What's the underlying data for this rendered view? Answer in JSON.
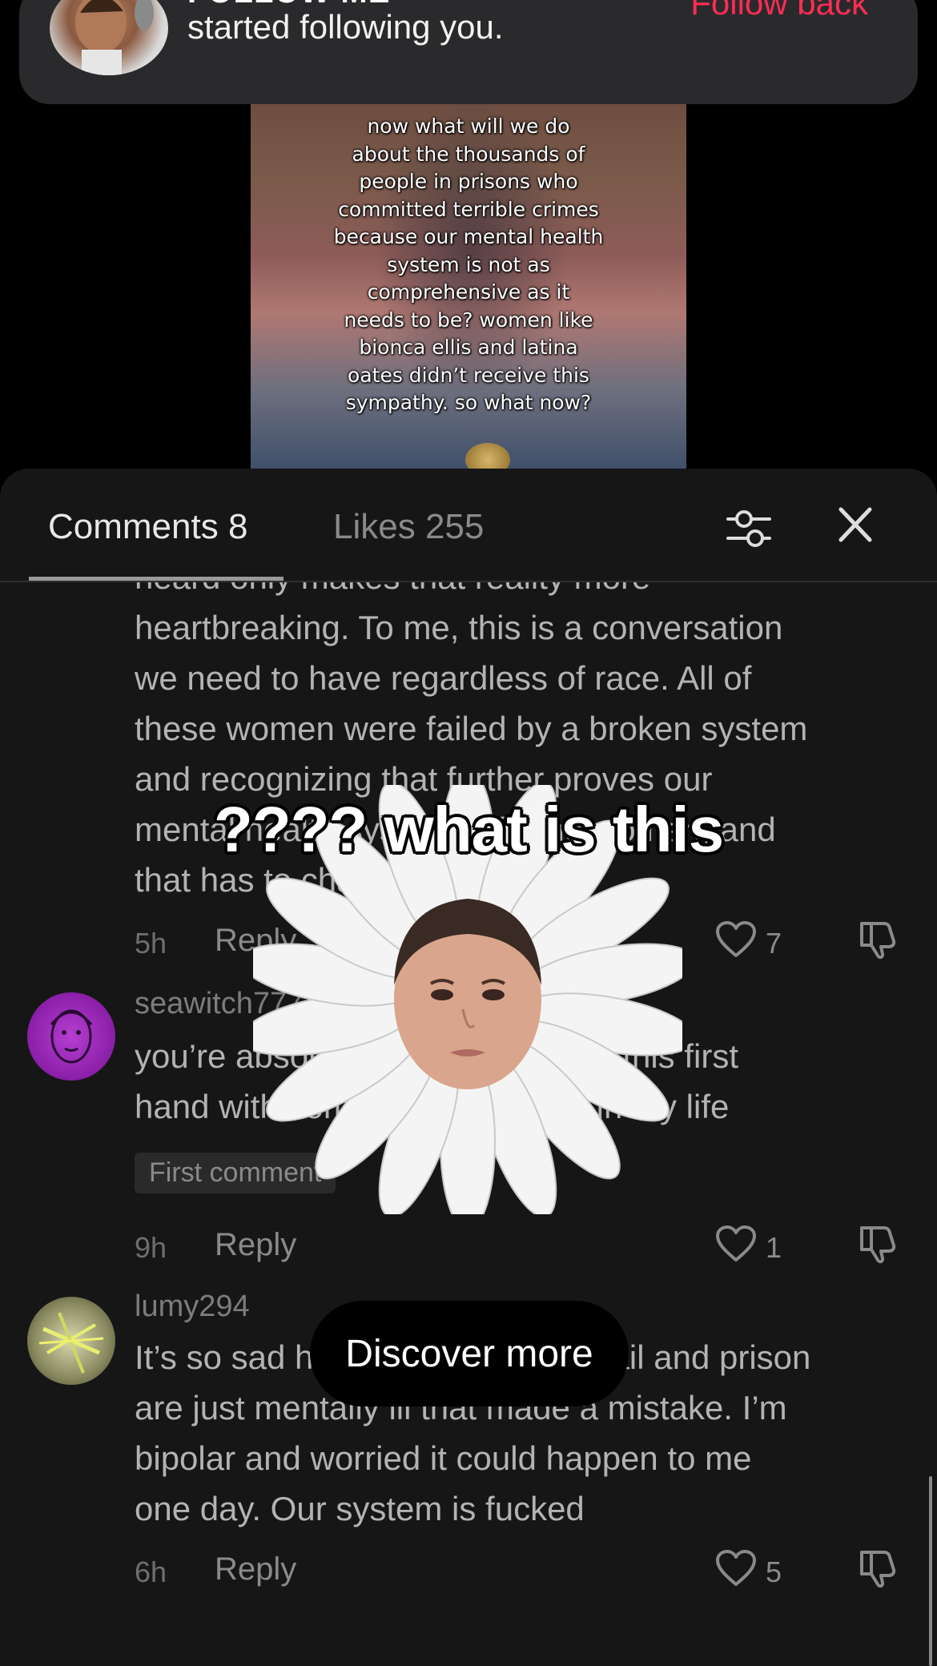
{
  "notification": {
    "title": "FOLLOW ME",
    "subtitle": "started following you.",
    "action": "Follow back"
  },
  "video": {
    "caption": "crimes while in psychosis.\n\nnow what will we do\nabout the thousands of\npeople in prisons who\ncommitted terrible crimes\nbecause our mental health\nsystem is not as\ncomprehensive as it\nneeds to be? women like\nbionca ellis and latina\noates didn’t receive this\nsympathy. so what now?"
  },
  "panel": {
    "tabs": [
      {
        "label": "Comments 8"
      },
      {
        "label": "Likes 255"
      }
    ]
  },
  "comments": [
    {
      "text_lines": [
        "heard only makes that reality more",
        "heartbreaking. To me, this is a conversation",
        "we need to have regardless of race. All of",
        "these women were failed by a broken system",
        "and recognizing that further proves our",
        "mental health system is failing women, and",
        "that has to change."
      ],
      "time": "5h",
      "reply": "Reply",
      "likes": "7"
    },
    {
      "username": "seawitch777",
      "text_lines": [
        "you’re absolutely right. i’ve seen this first",
        "hand with someone very close in my life"
      ],
      "badge": "First comment",
      "time": "9h",
      "reply": "Reply",
      "likes": "1"
    },
    {
      "username": "lumy294",
      "text_lines": [
        "It’s so sad how many people in jail and prison",
        "are just mentally ill that made a mistake. I’m",
        "bipolar and worried it could happen to me",
        "one day. Our system is fucked"
      ],
      "time": "6h",
      "reply": "Reply",
      "likes": "5"
    }
  ],
  "overlay": {
    "caption": "???? what is this",
    "discover": "Discover more"
  },
  "colors": {
    "accent": "#fe2c55",
    "panel_bg": "#161616",
    "notification_bg": "#2a2a2c"
  },
  "icons": [
    "filter-sliders-icon",
    "close-icon",
    "heart-icon",
    "dislike-icon"
  ]
}
